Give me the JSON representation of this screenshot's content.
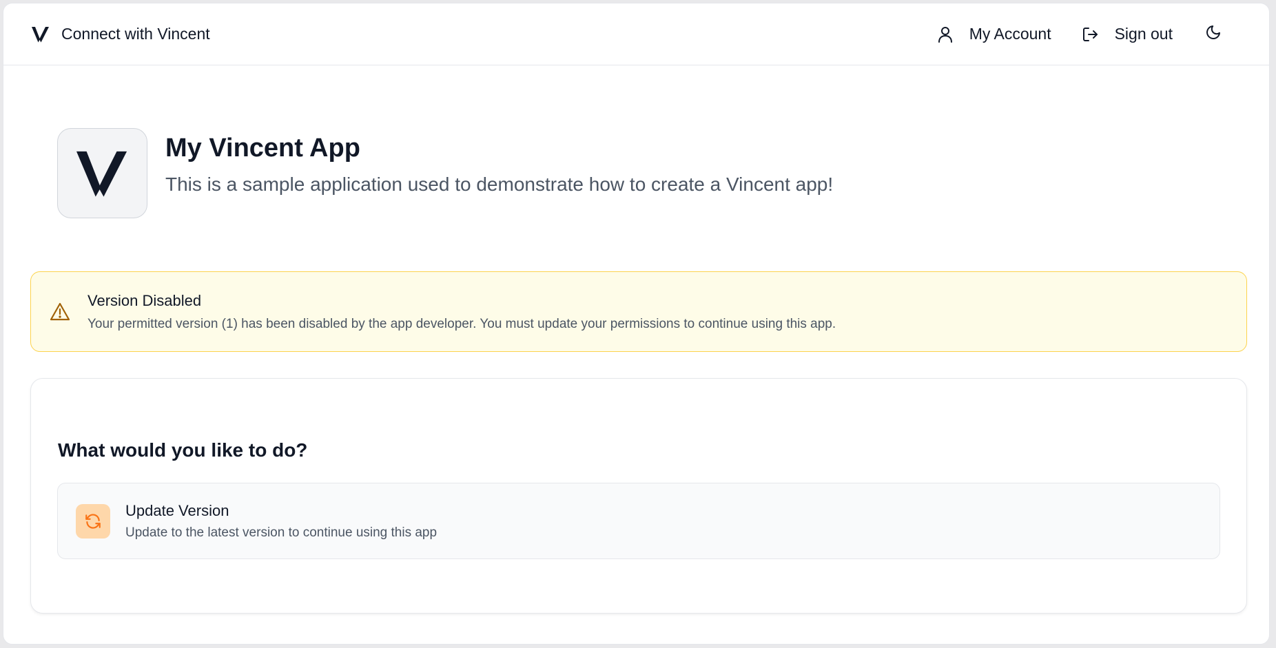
{
  "header": {
    "brand_title": "Connect with Vincent",
    "account_label": "My Account",
    "signout_label": "Sign out",
    "icons": {
      "brand": "vincent-logo-icon",
      "account": "user-icon",
      "signout": "sign-out-icon",
      "theme": "moon-icon"
    }
  },
  "app": {
    "name": "My Vincent App",
    "description": "This is a sample application used to demonstrate how to create a Vincent app!"
  },
  "warning": {
    "title": "Version Disabled",
    "message": "Your permitted version (1) has been disabled by the app developer. You must update your permissions to continue using this app.",
    "icon": "warning-triangle-icon",
    "colors": {
      "background": "#fefce8",
      "border": "#fcd34d",
      "icon": "#a16207"
    }
  },
  "actions": {
    "title": "What would you like to do?",
    "options": [
      {
        "title": "Update Version",
        "subtitle": "Update to the latest version to continue using this app",
        "icon": "refresh-icon",
        "icon_color": "#f97316",
        "icon_bg": "#fed7aa"
      }
    ]
  }
}
